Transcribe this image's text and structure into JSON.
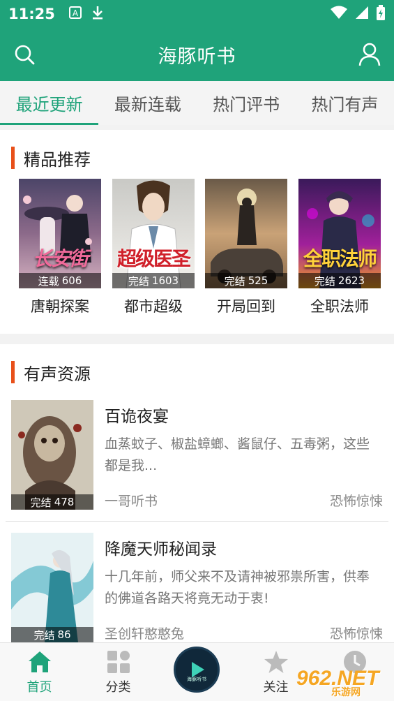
{
  "status_bar": {
    "time": "11:25",
    "icons": [
      "a-icon",
      "download-icon",
      "wifi-icon",
      "signal-icon",
      "battery-icon"
    ]
  },
  "header": {
    "title": "海豚听书",
    "left_icon": "search-icon",
    "right_icon": "user-icon"
  },
  "tabs": [
    {
      "label": "最近更新",
      "active": true
    },
    {
      "label": "最新连载",
      "active": false
    },
    {
      "label": "热门评书",
      "active": false
    },
    {
      "label": "热门有声",
      "active": false
    }
  ],
  "featured": {
    "title": "精品推荐",
    "books": [
      {
        "name": "唐朝探案",
        "status": "连载",
        "count": "606",
        "cover_text": "长安街"
      },
      {
        "name": "都市超级",
        "status": "完结",
        "count": "1603",
        "cover_text": "超级医圣"
      },
      {
        "name": "开局回到",
        "status": "完结",
        "count": "525",
        "cover_text": ""
      },
      {
        "name": "全职法师",
        "status": "完结",
        "count": "2623",
        "cover_text": "全职法师"
      }
    ]
  },
  "audio": {
    "title": "有声资源",
    "items": [
      {
        "title": "百诡夜宴",
        "desc": "血蒸蚊子、椒盐蟑螂、酱鼠仔、五毒粥，这些都是我...",
        "author": "一哥听书",
        "tag": "恐怖惊悚",
        "status": "完结",
        "count": "478"
      },
      {
        "title": "降魔天师秘闻录",
        "desc": "十几年前，师父来不及请神被邪祟所害，供奉的佛道各路天将竟无动于衷!",
        "author": "圣创轩憨憨兔",
        "tag": "恐怖惊悚",
        "status": "完结",
        "count": "86"
      }
    ]
  },
  "bottom_nav": [
    {
      "label": "首页",
      "icon": "home-icon",
      "active": true
    },
    {
      "label": "分类",
      "icon": "category-icon",
      "active": false
    },
    {
      "label": "",
      "icon": "player-icon",
      "active": false
    },
    {
      "label": "关注",
      "icon": "star-icon",
      "active": false
    },
    {
      "label": "",
      "icon": "history-icon",
      "active": false
    }
  ],
  "player_label": "海豚听书",
  "watermark": {
    "main": "962.NET",
    "sub": "乐游网"
  },
  "colors": {
    "brand": "#1fa37a",
    "accent_bar": "#e8501a"
  }
}
